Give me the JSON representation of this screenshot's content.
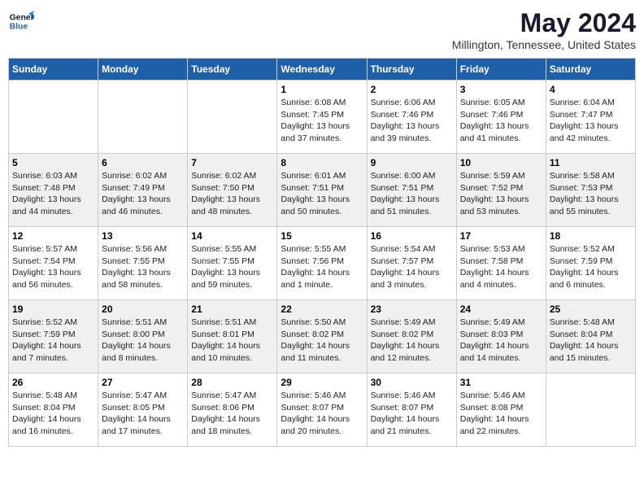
{
  "header": {
    "logo_line1": "General",
    "logo_line2": "Blue",
    "title": "May 2024",
    "location": "Millington, Tennessee, United States"
  },
  "weekdays": [
    "Sunday",
    "Monday",
    "Tuesday",
    "Wednesday",
    "Thursday",
    "Friday",
    "Saturday"
  ],
  "weeks": [
    [
      {
        "day": "",
        "info": ""
      },
      {
        "day": "",
        "info": ""
      },
      {
        "day": "",
        "info": ""
      },
      {
        "day": "1",
        "info": "Sunrise: 6:08 AM\nSunset: 7:45 PM\nDaylight: 13 hours\nand 37 minutes."
      },
      {
        "day": "2",
        "info": "Sunrise: 6:06 AM\nSunset: 7:46 PM\nDaylight: 13 hours\nand 39 minutes."
      },
      {
        "day": "3",
        "info": "Sunrise: 6:05 AM\nSunset: 7:46 PM\nDaylight: 13 hours\nand 41 minutes."
      },
      {
        "day": "4",
        "info": "Sunrise: 6:04 AM\nSunset: 7:47 PM\nDaylight: 13 hours\nand 42 minutes."
      }
    ],
    [
      {
        "day": "5",
        "info": "Sunrise: 6:03 AM\nSunset: 7:48 PM\nDaylight: 13 hours\nand 44 minutes."
      },
      {
        "day": "6",
        "info": "Sunrise: 6:02 AM\nSunset: 7:49 PM\nDaylight: 13 hours\nand 46 minutes."
      },
      {
        "day": "7",
        "info": "Sunrise: 6:02 AM\nSunset: 7:50 PM\nDaylight: 13 hours\nand 48 minutes."
      },
      {
        "day": "8",
        "info": "Sunrise: 6:01 AM\nSunset: 7:51 PM\nDaylight: 13 hours\nand 50 minutes."
      },
      {
        "day": "9",
        "info": "Sunrise: 6:00 AM\nSunset: 7:51 PM\nDaylight: 13 hours\nand 51 minutes."
      },
      {
        "day": "10",
        "info": "Sunrise: 5:59 AM\nSunset: 7:52 PM\nDaylight: 13 hours\nand 53 minutes."
      },
      {
        "day": "11",
        "info": "Sunrise: 5:58 AM\nSunset: 7:53 PM\nDaylight: 13 hours\nand 55 minutes."
      }
    ],
    [
      {
        "day": "12",
        "info": "Sunrise: 5:57 AM\nSunset: 7:54 PM\nDaylight: 13 hours\nand 56 minutes."
      },
      {
        "day": "13",
        "info": "Sunrise: 5:56 AM\nSunset: 7:55 PM\nDaylight: 13 hours\nand 58 minutes."
      },
      {
        "day": "14",
        "info": "Sunrise: 5:55 AM\nSunset: 7:55 PM\nDaylight: 13 hours\nand 59 minutes."
      },
      {
        "day": "15",
        "info": "Sunrise: 5:55 AM\nSunset: 7:56 PM\nDaylight: 14 hours\nand 1 minute."
      },
      {
        "day": "16",
        "info": "Sunrise: 5:54 AM\nSunset: 7:57 PM\nDaylight: 14 hours\nand 3 minutes."
      },
      {
        "day": "17",
        "info": "Sunrise: 5:53 AM\nSunset: 7:58 PM\nDaylight: 14 hours\nand 4 minutes."
      },
      {
        "day": "18",
        "info": "Sunrise: 5:52 AM\nSunset: 7:59 PM\nDaylight: 14 hours\nand 6 minutes."
      }
    ],
    [
      {
        "day": "19",
        "info": "Sunrise: 5:52 AM\nSunset: 7:59 PM\nDaylight: 14 hours\nand 7 minutes."
      },
      {
        "day": "20",
        "info": "Sunrise: 5:51 AM\nSunset: 8:00 PM\nDaylight: 14 hours\nand 8 minutes."
      },
      {
        "day": "21",
        "info": "Sunrise: 5:51 AM\nSunset: 8:01 PM\nDaylight: 14 hours\nand 10 minutes."
      },
      {
        "day": "22",
        "info": "Sunrise: 5:50 AM\nSunset: 8:02 PM\nDaylight: 14 hours\nand 11 minutes."
      },
      {
        "day": "23",
        "info": "Sunrise: 5:49 AM\nSunset: 8:02 PM\nDaylight: 14 hours\nand 12 minutes."
      },
      {
        "day": "24",
        "info": "Sunrise: 5:49 AM\nSunset: 8:03 PM\nDaylight: 14 hours\nand 14 minutes."
      },
      {
        "day": "25",
        "info": "Sunrise: 5:48 AM\nSunset: 8:04 PM\nDaylight: 14 hours\nand 15 minutes."
      }
    ],
    [
      {
        "day": "26",
        "info": "Sunrise: 5:48 AM\nSunset: 8:04 PM\nDaylight: 14 hours\nand 16 minutes."
      },
      {
        "day": "27",
        "info": "Sunrise: 5:47 AM\nSunset: 8:05 PM\nDaylight: 14 hours\nand 17 minutes."
      },
      {
        "day": "28",
        "info": "Sunrise: 5:47 AM\nSunset: 8:06 PM\nDaylight: 14 hours\nand 18 minutes."
      },
      {
        "day": "29",
        "info": "Sunrise: 5:46 AM\nSunset: 8:07 PM\nDaylight: 14 hours\nand 20 minutes."
      },
      {
        "day": "30",
        "info": "Sunrise: 5:46 AM\nSunset: 8:07 PM\nDaylight: 14 hours\nand 21 minutes."
      },
      {
        "day": "31",
        "info": "Sunrise: 5:46 AM\nSunset: 8:08 PM\nDaylight: 14 hours\nand 22 minutes."
      },
      {
        "day": "",
        "info": ""
      }
    ]
  ]
}
